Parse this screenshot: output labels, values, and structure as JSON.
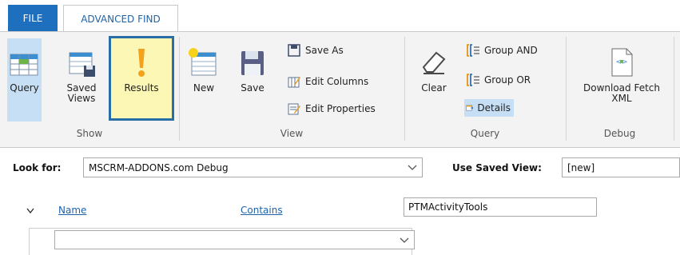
{
  "tabs": {
    "file": "FILE",
    "advanced_find": "ADVANCED FIND"
  },
  "ribbon": {
    "show": {
      "label": "Show",
      "query": "Query",
      "saved_views": "Saved\nViews",
      "results": "Results"
    },
    "view": {
      "label": "View",
      "new": "New",
      "save": "Save",
      "save_as": "Save As",
      "edit_columns": "Edit Columns",
      "edit_properties": "Edit Properties"
    },
    "query": {
      "label": "Query",
      "clear": "Clear",
      "group_and": "Group AND",
      "group_or": "Group OR",
      "details": "Details"
    },
    "debug": {
      "label": "Debug",
      "download_fetch_xml": "Download Fetch\nXML"
    }
  },
  "form": {
    "look_for_label": "Look for:",
    "look_for_value": "MSCRM-ADDONS.com Debug",
    "use_saved_view_label": "Use Saved View:",
    "use_saved_view_value": "[new]",
    "condition": {
      "field": "Name",
      "operator": "Contains",
      "value": "PTMActivityTools"
    },
    "new_condition_value": ""
  },
  "colors": {
    "file_tab": "#1f6fbf",
    "accent_text": "#1e63a8",
    "results_highlight": "#fdf7b5",
    "results_border": "#2a6ea8",
    "selected_bg": "#c7dff5"
  }
}
